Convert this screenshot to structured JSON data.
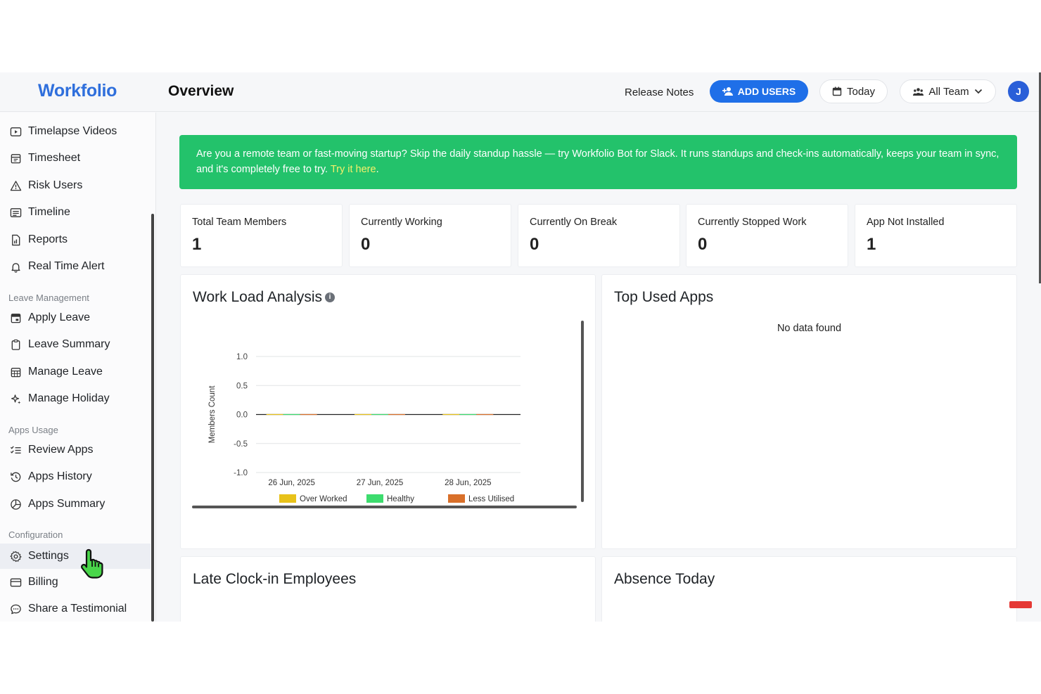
{
  "app": {
    "logo": "Workfolio",
    "page_title": "Overview"
  },
  "header": {
    "release_notes": "Release Notes",
    "add_users": "ADD USERS",
    "today": "Today",
    "team_filter": "All Team",
    "avatar_initial": "J"
  },
  "sidebar": {
    "items_top": [
      {
        "label": "Timelapse Videos",
        "icon": "play-icon"
      },
      {
        "label": "Timesheet",
        "icon": "calendar-icon"
      },
      {
        "label": "Risk Users",
        "icon": "warning-icon"
      },
      {
        "label": "Timeline",
        "icon": "timeline-icon"
      },
      {
        "label": "Reports",
        "icon": "report-icon"
      },
      {
        "label": "Real Time Alert",
        "icon": "bell-icon"
      }
    ],
    "leave_section": "Leave Management",
    "leave_items": [
      {
        "label": "Apply Leave",
        "icon": "calendar-icon"
      },
      {
        "label": "Leave Summary",
        "icon": "clipboard-icon"
      },
      {
        "label": "Manage Leave",
        "icon": "calendar-grid-icon"
      },
      {
        "label": "Manage Holiday",
        "icon": "sparkle-icon"
      }
    ],
    "apps_section": "Apps Usage",
    "apps_items": [
      {
        "label": "Review Apps",
        "icon": "checklist-icon"
      },
      {
        "label": "Apps History",
        "icon": "history-icon"
      },
      {
        "label": "Apps Summary",
        "icon": "pie-icon"
      }
    ],
    "config_section": "Configuration",
    "config_items": [
      {
        "label": "Settings",
        "icon": "gear-icon"
      },
      {
        "label": "Billing",
        "icon": "card-icon"
      },
      {
        "label": "Share a Testimonial",
        "icon": "chat-icon"
      }
    ]
  },
  "banner": {
    "text": "Are you a remote team or fast-moving startup? Skip the daily standup hassle — try Workfolio Bot for Slack. It runs standups and check-ins automatically, keeps your team in sync, and it's completely free to try. ",
    "link": "Try it here",
    "end": ".",
    "color": "#23c26b"
  },
  "stats": [
    {
      "label": "Total Team Members",
      "value": "1"
    },
    {
      "label": "Currently Working",
      "value": "0"
    },
    {
      "label": "Currently On Break",
      "value": "0"
    },
    {
      "label": "Currently Stopped Work",
      "value": "0"
    },
    {
      "label": "App Not Installed",
      "value": "1"
    }
  ],
  "workload": {
    "title": "Work Load Analysis",
    "info": "i"
  },
  "top_apps": {
    "title": "Top Used Apps",
    "empty": "No data found"
  },
  "late_clock": {
    "title": "Late Clock-in Employees"
  },
  "absence": {
    "title": "Absence Today"
  },
  "chart_data": {
    "type": "bar",
    "categories": [
      "26 Jun, 2025",
      "27 Jun, 2025",
      "28 Jun, 2025"
    ],
    "series": [
      {
        "name": "Over Worked",
        "values": [
          0,
          0,
          0
        ],
        "color": "#e8c21a"
      },
      {
        "name": "Healthy",
        "values": [
          0,
          0,
          0
        ],
        "color": "#3ddc6e"
      },
      {
        "name": "Less Utilised",
        "values": [
          0,
          0,
          0
        ],
        "color": "#d9702a"
      }
    ],
    "ylabel": "Members Count",
    "yticks": [
      "1.0",
      "0.5",
      "0.0",
      "-0.5",
      "-1.0"
    ],
    "ylim": [
      -1,
      1
    ],
    "grid": true,
    "legend": "bottom"
  }
}
